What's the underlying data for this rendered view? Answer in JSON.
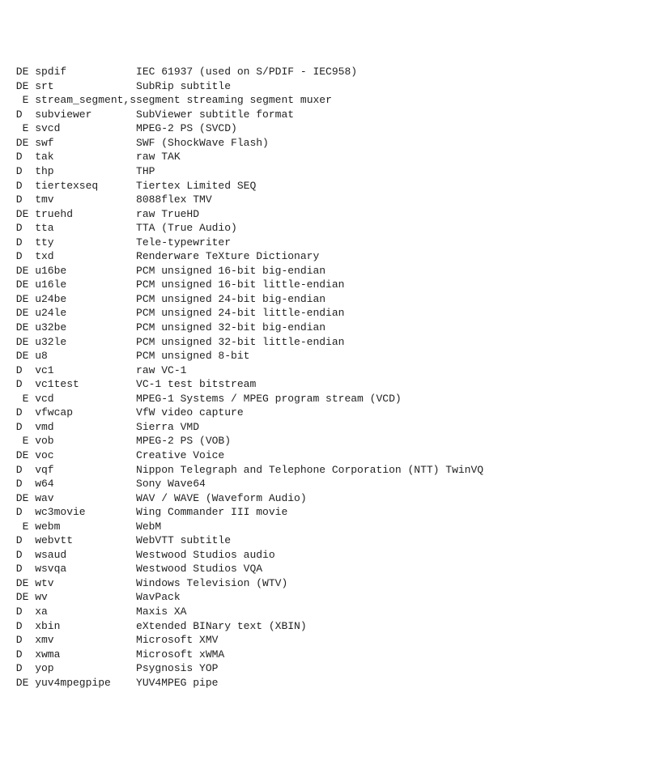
{
  "rows": [
    {
      "flags": " DE",
      "name": "spdif",
      "desc": "IEC 61937 (used on S/PDIF - IEC958)"
    },
    {
      "flags": " DE",
      "name": "srt",
      "desc": "SubRip subtitle"
    },
    {
      "flags": "  E",
      "name": "stream_segment,ssegment",
      "desc": "streaming segment muxer",
      "compact": true
    },
    {
      "flags": " D ",
      "name": "subviewer",
      "desc": "SubViewer subtitle format"
    },
    {
      "flags": "  E",
      "name": "svcd",
      "desc": "MPEG-2 PS (SVCD)"
    },
    {
      "flags": " DE",
      "name": "swf",
      "desc": "SWF (ShockWave Flash)"
    },
    {
      "flags": " D ",
      "name": "tak",
      "desc": "raw TAK"
    },
    {
      "flags": " D ",
      "name": "thp",
      "desc": "THP"
    },
    {
      "flags": " D ",
      "name": "tiertexseq",
      "desc": "Tiertex Limited SEQ"
    },
    {
      "flags": " D ",
      "name": "tmv",
      "desc": "8088flex TMV"
    },
    {
      "flags": " DE",
      "name": "truehd",
      "desc": "raw TrueHD"
    },
    {
      "flags": " D ",
      "name": "tta",
      "desc": "TTA (True Audio)"
    },
    {
      "flags": " D ",
      "name": "tty",
      "desc": "Tele-typewriter"
    },
    {
      "flags": " D ",
      "name": "txd",
      "desc": "Renderware TeXture Dictionary"
    },
    {
      "flags": " DE",
      "name": "u16be",
      "desc": "PCM unsigned 16-bit big-endian"
    },
    {
      "flags": " DE",
      "name": "u16le",
      "desc": "PCM unsigned 16-bit little-endian"
    },
    {
      "flags": " DE",
      "name": "u24be",
      "desc": "PCM unsigned 24-bit big-endian"
    },
    {
      "flags": " DE",
      "name": "u24le",
      "desc": "PCM unsigned 24-bit little-endian"
    },
    {
      "flags": " DE",
      "name": "u32be",
      "desc": "PCM unsigned 32-bit big-endian"
    },
    {
      "flags": " DE",
      "name": "u32le",
      "desc": "PCM unsigned 32-bit little-endian"
    },
    {
      "flags": " DE",
      "name": "u8",
      "desc": "PCM unsigned 8-bit"
    },
    {
      "flags": " D ",
      "name": "vc1",
      "desc": "raw VC-1"
    },
    {
      "flags": " D ",
      "name": "vc1test",
      "desc": "VC-1 test bitstream"
    },
    {
      "flags": "  E",
      "name": "vcd",
      "desc": "MPEG-1 Systems / MPEG program stream (VCD)"
    },
    {
      "flags": " D ",
      "name": "vfwcap",
      "desc": "VfW video capture"
    },
    {
      "flags": " D ",
      "name": "vmd",
      "desc": "Sierra VMD"
    },
    {
      "flags": "  E",
      "name": "vob",
      "desc": "MPEG-2 PS (VOB)"
    },
    {
      "flags": " DE",
      "name": "voc",
      "desc": "Creative Voice"
    },
    {
      "flags": " D ",
      "name": "vqf",
      "desc": "Nippon Telegraph and Telephone Corporation (NTT) TwinVQ"
    },
    {
      "flags": " D ",
      "name": "w64",
      "desc": "Sony Wave64"
    },
    {
      "flags": " DE",
      "name": "wav",
      "desc": "WAV / WAVE (Waveform Audio)"
    },
    {
      "flags": " D ",
      "name": "wc3movie",
      "desc": "Wing Commander III movie"
    },
    {
      "flags": "  E",
      "name": "webm",
      "desc": "WebM"
    },
    {
      "flags": " D ",
      "name": "webvtt",
      "desc": "WebVTT subtitle"
    },
    {
      "flags": " D ",
      "name": "wsaud",
      "desc": "Westwood Studios audio"
    },
    {
      "flags": " D ",
      "name": "wsvqa",
      "desc": "Westwood Studios VQA"
    },
    {
      "flags": " DE",
      "name": "wtv",
      "desc": "Windows Television (WTV)"
    },
    {
      "flags": " DE",
      "name": "wv",
      "desc": "WavPack"
    },
    {
      "flags": " D ",
      "name": "xa",
      "desc": "Maxis XA"
    },
    {
      "flags": " D ",
      "name": "xbin",
      "desc": "eXtended BINary text (XBIN)"
    },
    {
      "flags": " D ",
      "name": "xmv",
      "desc": "Microsoft XMV"
    },
    {
      "flags": " D ",
      "name": "xwma",
      "desc": "Microsoft xWMA"
    },
    {
      "flags": " D ",
      "name": "yop",
      "desc": "Psygnosis YOP"
    },
    {
      "flags": " DE",
      "name": "yuv4mpegpipe",
      "desc": "YUV4MPEG pipe"
    }
  ]
}
